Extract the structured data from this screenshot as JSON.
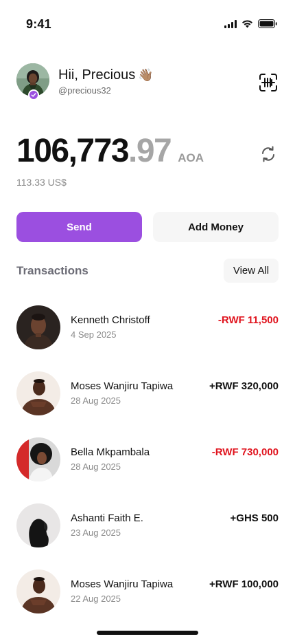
{
  "status_bar": {
    "time": "9:41"
  },
  "header": {
    "greeting": "Hii, Precious",
    "wave_emoji": "👋🏽",
    "username": "@precious32",
    "verified_color": "#9b4fe0"
  },
  "balance": {
    "integer": "106,773",
    "decimal": ".97",
    "currency": "AOA",
    "usd_equivalent": "113.33 US$"
  },
  "actions": {
    "send_label": "Send",
    "add_money_label": "Add Money",
    "accent_color": "#9b4fe0"
  },
  "transactions": {
    "title": "Transactions",
    "view_all_label": "View All",
    "items": [
      {
        "name": "Kenneth Christoff",
        "date": "4 Sep 2025",
        "amount": "-RWF 11,500",
        "direction": "out"
      },
      {
        "name": "Moses Wanjiru Tapiwa",
        "date": "28 Aug 2025",
        "amount": "+RWF 320,000",
        "direction": "in"
      },
      {
        "name": "Bella Mkpambala",
        "date": "28 Aug 2025",
        "amount": "-RWF 730,000",
        "direction": "out"
      },
      {
        "name": "Ashanti Faith E.",
        "date": "23 Aug 2025",
        "amount": "+GHS 500",
        "direction": "in"
      },
      {
        "name": "Moses Wanjiru Tapiwa",
        "date": "22 Aug 2025",
        "amount": "+RWF 100,000",
        "direction": "in"
      }
    ]
  },
  "colors": {
    "negative": "#e0141e",
    "positive": "#111111"
  }
}
